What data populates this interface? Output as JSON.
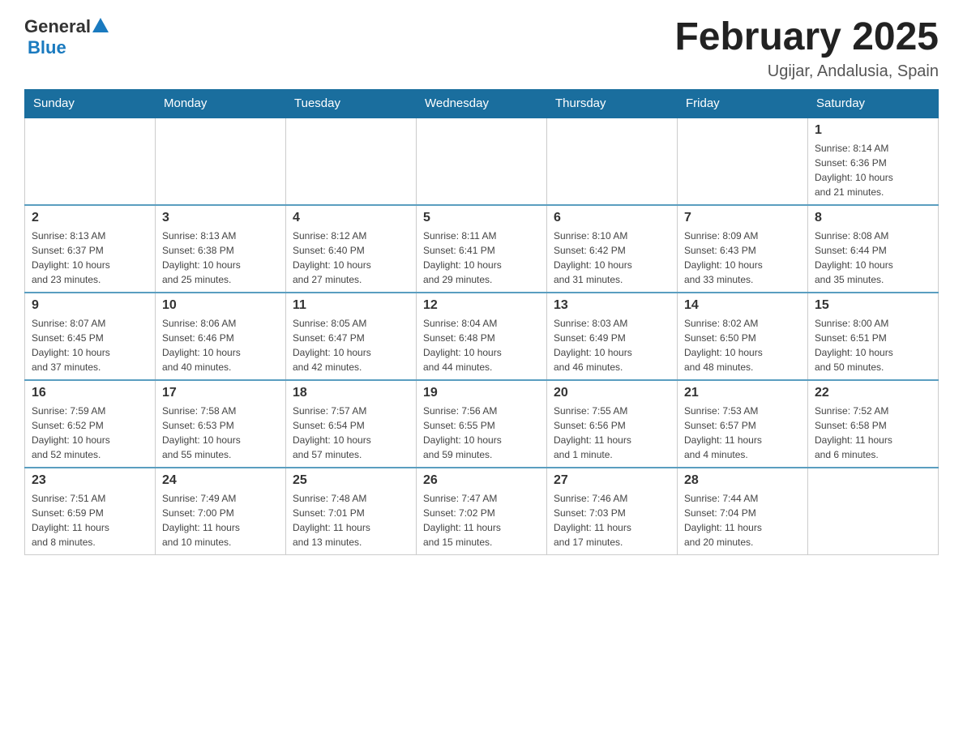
{
  "logo": {
    "text_general": "General",
    "text_blue": "Blue"
  },
  "title": "February 2025",
  "location": "Ugijar, Andalusia, Spain",
  "days_of_week": [
    "Sunday",
    "Monday",
    "Tuesday",
    "Wednesday",
    "Thursday",
    "Friday",
    "Saturday"
  ],
  "weeks": [
    [
      {
        "day": "",
        "info": ""
      },
      {
        "day": "",
        "info": ""
      },
      {
        "day": "",
        "info": ""
      },
      {
        "day": "",
        "info": ""
      },
      {
        "day": "",
        "info": ""
      },
      {
        "day": "",
        "info": ""
      },
      {
        "day": "1",
        "info": "Sunrise: 8:14 AM\nSunset: 6:36 PM\nDaylight: 10 hours\nand 21 minutes."
      }
    ],
    [
      {
        "day": "2",
        "info": "Sunrise: 8:13 AM\nSunset: 6:37 PM\nDaylight: 10 hours\nand 23 minutes."
      },
      {
        "day": "3",
        "info": "Sunrise: 8:13 AM\nSunset: 6:38 PM\nDaylight: 10 hours\nand 25 minutes."
      },
      {
        "day": "4",
        "info": "Sunrise: 8:12 AM\nSunset: 6:40 PM\nDaylight: 10 hours\nand 27 minutes."
      },
      {
        "day": "5",
        "info": "Sunrise: 8:11 AM\nSunset: 6:41 PM\nDaylight: 10 hours\nand 29 minutes."
      },
      {
        "day": "6",
        "info": "Sunrise: 8:10 AM\nSunset: 6:42 PM\nDaylight: 10 hours\nand 31 minutes."
      },
      {
        "day": "7",
        "info": "Sunrise: 8:09 AM\nSunset: 6:43 PM\nDaylight: 10 hours\nand 33 minutes."
      },
      {
        "day": "8",
        "info": "Sunrise: 8:08 AM\nSunset: 6:44 PM\nDaylight: 10 hours\nand 35 minutes."
      }
    ],
    [
      {
        "day": "9",
        "info": "Sunrise: 8:07 AM\nSunset: 6:45 PM\nDaylight: 10 hours\nand 37 minutes."
      },
      {
        "day": "10",
        "info": "Sunrise: 8:06 AM\nSunset: 6:46 PM\nDaylight: 10 hours\nand 40 minutes."
      },
      {
        "day": "11",
        "info": "Sunrise: 8:05 AM\nSunset: 6:47 PM\nDaylight: 10 hours\nand 42 minutes."
      },
      {
        "day": "12",
        "info": "Sunrise: 8:04 AM\nSunset: 6:48 PM\nDaylight: 10 hours\nand 44 minutes."
      },
      {
        "day": "13",
        "info": "Sunrise: 8:03 AM\nSunset: 6:49 PM\nDaylight: 10 hours\nand 46 minutes."
      },
      {
        "day": "14",
        "info": "Sunrise: 8:02 AM\nSunset: 6:50 PM\nDaylight: 10 hours\nand 48 minutes."
      },
      {
        "day": "15",
        "info": "Sunrise: 8:00 AM\nSunset: 6:51 PM\nDaylight: 10 hours\nand 50 minutes."
      }
    ],
    [
      {
        "day": "16",
        "info": "Sunrise: 7:59 AM\nSunset: 6:52 PM\nDaylight: 10 hours\nand 52 minutes."
      },
      {
        "day": "17",
        "info": "Sunrise: 7:58 AM\nSunset: 6:53 PM\nDaylight: 10 hours\nand 55 minutes."
      },
      {
        "day": "18",
        "info": "Sunrise: 7:57 AM\nSunset: 6:54 PM\nDaylight: 10 hours\nand 57 minutes."
      },
      {
        "day": "19",
        "info": "Sunrise: 7:56 AM\nSunset: 6:55 PM\nDaylight: 10 hours\nand 59 minutes."
      },
      {
        "day": "20",
        "info": "Sunrise: 7:55 AM\nSunset: 6:56 PM\nDaylight: 11 hours\nand 1 minute."
      },
      {
        "day": "21",
        "info": "Sunrise: 7:53 AM\nSunset: 6:57 PM\nDaylight: 11 hours\nand 4 minutes."
      },
      {
        "day": "22",
        "info": "Sunrise: 7:52 AM\nSunset: 6:58 PM\nDaylight: 11 hours\nand 6 minutes."
      }
    ],
    [
      {
        "day": "23",
        "info": "Sunrise: 7:51 AM\nSunset: 6:59 PM\nDaylight: 11 hours\nand 8 minutes."
      },
      {
        "day": "24",
        "info": "Sunrise: 7:49 AM\nSunset: 7:00 PM\nDaylight: 11 hours\nand 10 minutes."
      },
      {
        "day": "25",
        "info": "Sunrise: 7:48 AM\nSunset: 7:01 PM\nDaylight: 11 hours\nand 13 minutes."
      },
      {
        "day": "26",
        "info": "Sunrise: 7:47 AM\nSunset: 7:02 PM\nDaylight: 11 hours\nand 15 minutes."
      },
      {
        "day": "27",
        "info": "Sunrise: 7:46 AM\nSunset: 7:03 PM\nDaylight: 11 hours\nand 17 minutes."
      },
      {
        "day": "28",
        "info": "Sunrise: 7:44 AM\nSunset: 7:04 PM\nDaylight: 11 hours\nand 20 minutes."
      },
      {
        "day": "",
        "info": ""
      }
    ]
  ]
}
